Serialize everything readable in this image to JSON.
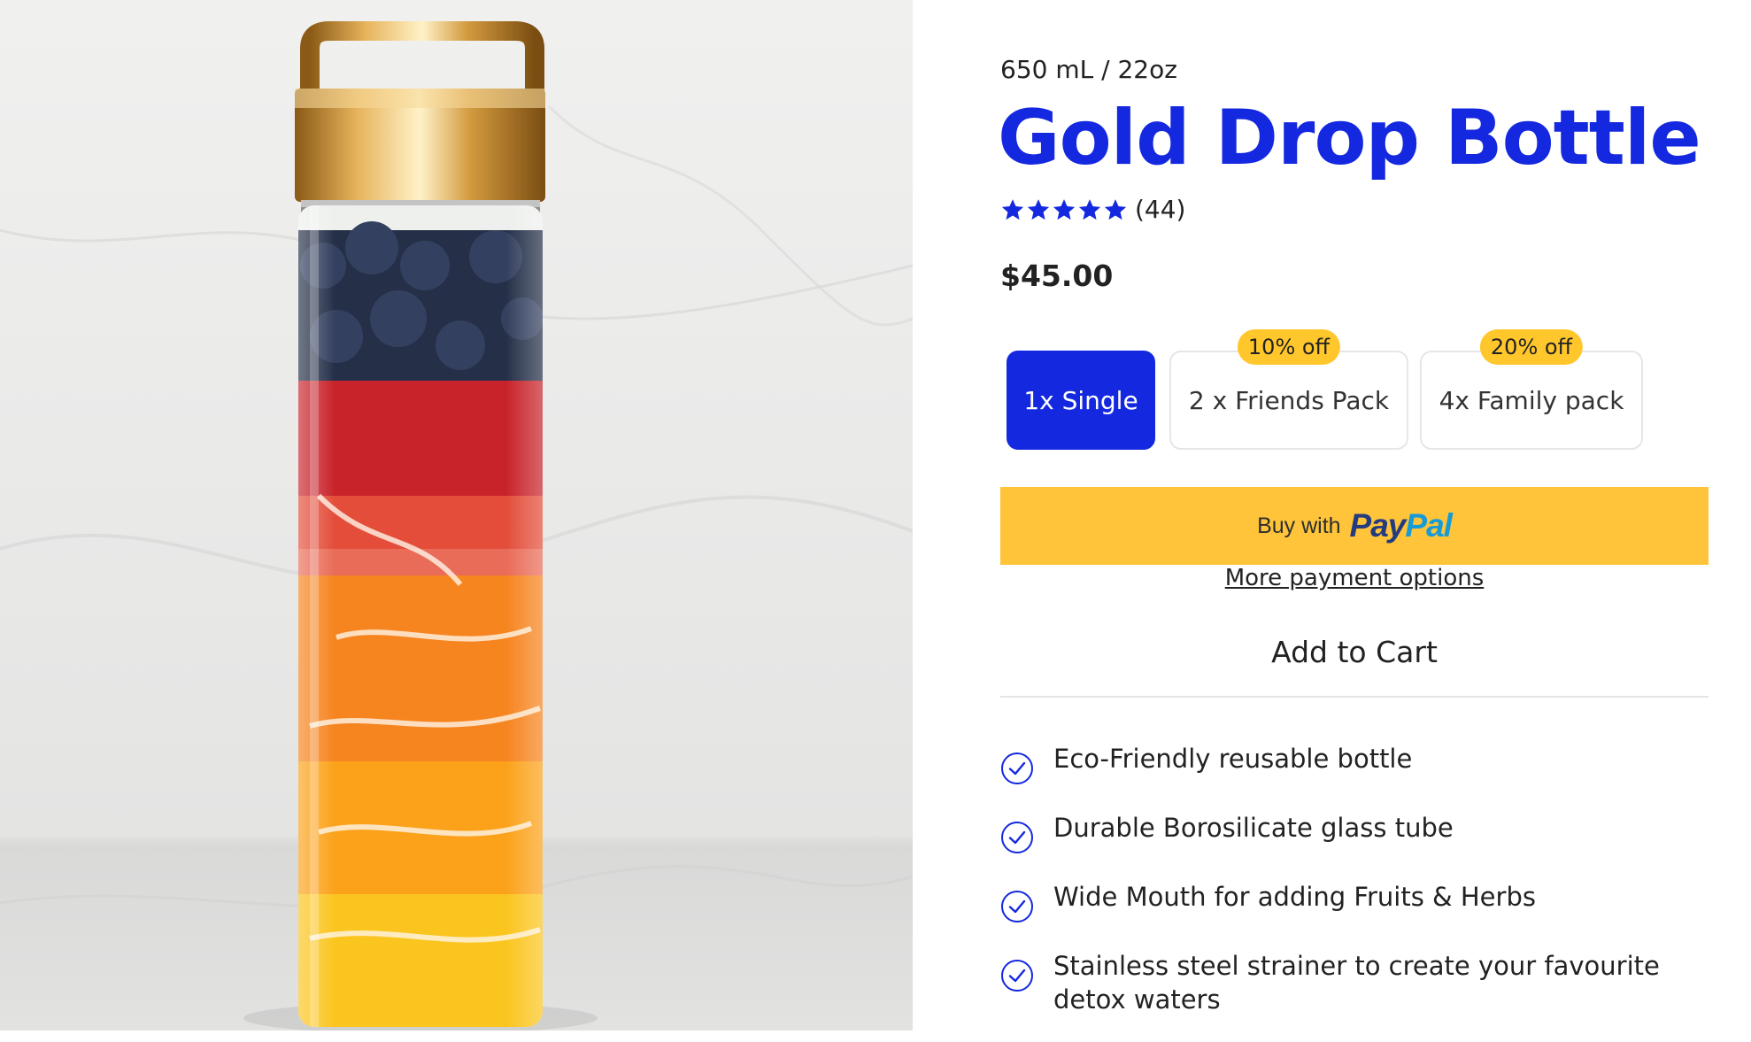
{
  "product": {
    "volume": "650 mL / 22oz",
    "title": "Gold Drop Bottle",
    "review_count": "(44)",
    "rating": 5,
    "max_rating": 5,
    "price": "$45.00"
  },
  "options": [
    {
      "label": "1x Single",
      "badge": "",
      "selected": true
    },
    {
      "label": "2 x Friends Pack",
      "badge": "10% off",
      "selected": false
    },
    {
      "label": "4x Family pack",
      "badge": "20% off",
      "selected": false
    }
  ],
  "checkout": {
    "paypal_prefix": "Buy with",
    "paypal_brand_a": "Pay",
    "paypal_brand_b": "Pal",
    "more_payment": "More payment options",
    "add_to_cart": "Add to Cart"
  },
  "features": [
    "Eco-Friendly reusable bottle",
    "Durable Borosilicate glass tube",
    "Wide Mouth for adding Fruits & Herbs",
    "Stainless steel strainer to create your favourite detox waters"
  ],
  "icons": {
    "star": "star-icon",
    "check": "check-circle-icon"
  },
  "colors": {
    "brand_blue": "#1428e0",
    "badge_yellow": "#ffc72c",
    "paypal_yellow": "#ffc439"
  }
}
